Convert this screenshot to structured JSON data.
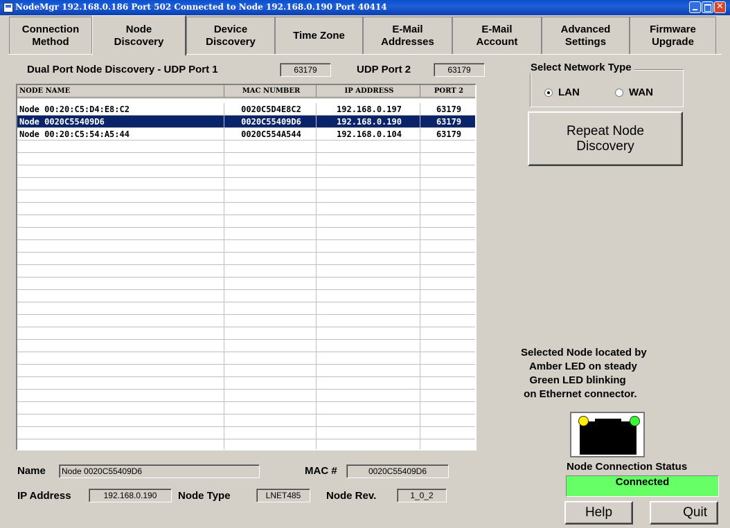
{
  "window": {
    "title": "NodeMgr 192.168.0.186 Port 502  Connected to  Node 192.168.0.190 Port 40414"
  },
  "tabs": [
    {
      "line1": "Connection",
      "line2": "Method"
    },
    {
      "line1": "Node",
      "line2": "Discovery"
    },
    {
      "line1": "Device",
      "line2": "Discovery"
    },
    {
      "line1": "Time Zone",
      "line2": ""
    },
    {
      "line1": "E-Mail",
      "line2": "Addresses"
    },
    {
      "line1": "E-Mail",
      "line2": "Account"
    },
    {
      "line1": "Advanced",
      "line2": "Settings"
    },
    {
      "line1": "Firmware",
      "line2": "Upgrade"
    }
  ],
  "discovery": {
    "label": "Dual Port Node Discovery - UDP Port 1",
    "udp_port1": "63179",
    "udp_port2_label": "UDP Port 2",
    "udp_port2": "63179"
  },
  "grid": {
    "headers": [
      "NODE NAME",
      "MAC NUMBER",
      "IP ADDRESS",
      "PORT 2"
    ],
    "rows": [
      [
        "Node 00:20:C5:D4:E8:C2",
        "0020C5D4E8C2",
        "192.168.0.197",
        "63179"
      ],
      [
        "Node 0020C55409D6",
        "0020C55409D6",
        "192.168.0.190",
        "63179"
      ],
      [
        "Node 00:20:C5:54:A5:44",
        "0020C554A544",
        "192.168.0.104",
        "63179"
      ]
    ],
    "selected_row": 1
  },
  "network": {
    "legend": "Select Network Type",
    "lan": "LAN",
    "wan": "WAN",
    "selected": "LAN"
  },
  "repeat_button": {
    "line1": "Repeat Node",
    "line2": "Discovery"
  },
  "info_text": "Selected Node located by\n   Amber LED on steady\n   Green LED blinking\n on Ethernet connector.",
  "details": {
    "name_label": "Name",
    "name_value": "Node 0020C55409D6",
    "mac_label": "MAC #",
    "mac_value": "0020C55409D6",
    "ip_label": "IP Address",
    "ip_value": "192.168.0.190",
    "type_label": "Node Type",
    "type_value": "LNET485",
    "rev_label": "Node Rev.",
    "rev_value": "1_0_2"
  },
  "connection_status": {
    "label": "Node Connection Status",
    "value": "Connected",
    "color": "#66ff66"
  },
  "buttons": {
    "help": "Help",
    "quit": "Quit"
  },
  "colors": {
    "title_bar": "#1f5fd6",
    "selection": "#0a246a",
    "face": "#d4d0c8"
  }
}
